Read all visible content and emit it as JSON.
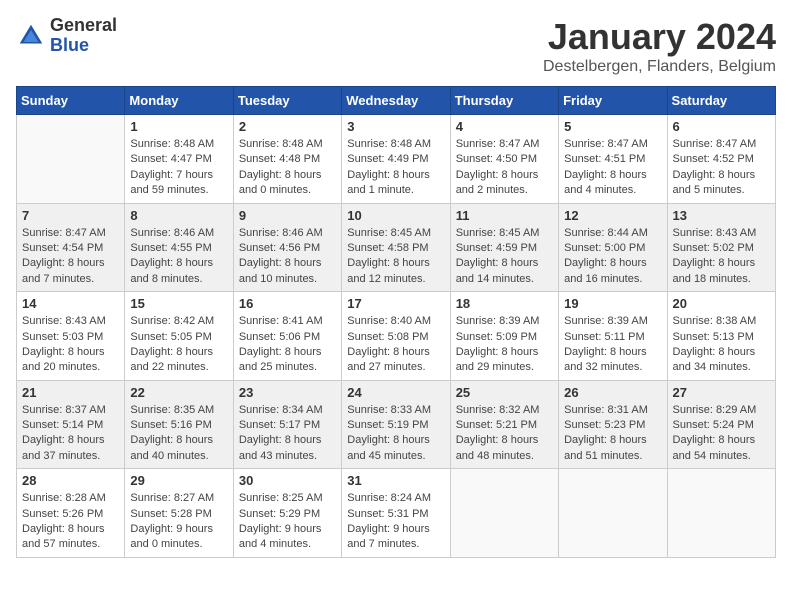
{
  "header": {
    "logo_general": "General",
    "logo_blue": "Blue",
    "month": "January 2024",
    "location": "Destelbergen, Flanders, Belgium"
  },
  "days_of_week": [
    "Sunday",
    "Monday",
    "Tuesday",
    "Wednesday",
    "Thursday",
    "Friday",
    "Saturday"
  ],
  "weeks": [
    [
      {
        "day": "",
        "empty": true
      },
      {
        "day": "1",
        "sunrise": "Sunrise: 8:48 AM",
        "sunset": "Sunset: 4:47 PM",
        "daylight": "Daylight: 7 hours and 59 minutes."
      },
      {
        "day": "2",
        "sunrise": "Sunrise: 8:48 AM",
        "sunset": "Sunset: 4:48 PM",
        "daylight": "Daylight: 8 hours and 0 minutes."
      },
      {
        "day": "3",
        "sunrise": "Sunrise: 8:48 AM",
        "sunset": "Sunset: 4:49 PM",
        "daylight": "Daylight: 8 hours and 1 minute."
      },
      {
        "day": "4",
        "sunrise": "Sunrise: 8:47 AM",
        "sunset": "Sunset: 4:50 PM",
        "daylight": "Daylight: 8 hours and 2 minutes."
      },
      {
        "day": "5",
        "sunrise": "Sunrise: 8:47 AM",
        "sunset": "Sunset: 4:51 PM",
        "daylight": "Daylight: 8 hours and 4 minutes."
      },
      {
        "day": "6",
        "sunrise": "Sunrise: 8:47 AM",
        "sunset": "Sunset: 4:52 PM",
        "daylight": "Daylight: 8 hours and 5 minutes."
      }
    ],
    [
      {
        "day": "7",
        "sunrise": "Sunrise: 8:47 AM",
        "sunset": "Sunset: 4:54 PM",
        "daylight": "Daylight: 8 hours and 7 minutes."
      },
      {
        "day": "8",
        "sunrise": "Sunrise: 8:46 AM",
        "sunset": "Sunset: 4:55 PM",
        "daylight": "Daylight: 8 hours and 8 minutes."
      },
      {
        "day": "9",
        "sunrise": "Sunrise: 8:46 AM",
        "sunset": "Sunset: 4:56 PM",
        "daylight": "Daylight: 8 hours and 10 minutes."
      },
      {
        "day": "10",
        "sunrise": "Sunrise: 8:45 AM",
        "sunset": "Sunset: 4:58 PM",
        "daylight": "Daylight: 8 hours and 12 minutes."
      },
      {
        "day": "11",
        "sunrise": "Sunrise: 8:45 AM",
        "sunset": "Sunset: 4:59 PM",
        "daylight": "Daylight: 8 hours and 14 minutes."
      },
      {
        "day": "12",
        "sunrise": "Sunrise: 8:44 AM",
        "sunset": "Sunset: 5:00 PM",
        "daylight": "Daylight: 8 hours and 16 minutes."
      },
      {
        "day": "13",
        "sunrise": "Sunrise: 8:43 AM",
        "sunset": "Sunset: 5:02 PM",
        "daylight": "Daylight: 8 hours and 18 minutes."
      }
    ],
    [
      {
        "day": "14",
        "sunrise": "Sunrise: 8:43 AM",
        "sunset": "Sunset: 5:03 PM",
        "daylight": "Daylight: 8 hours and 20 minutes."
      },
      {
        "day": "15",
        "sunrise": "Sunrise: 8:42 AM",
        "sunset": "Sunset: 5:05 PM",
        "daylight": "Daylight: 8 hours and 22 minutes."
      },
      {
        "day": "16",
        "sunrise": "Sunrise: 8:41 AM",
        "sunset": "Sunset: 5:06 PM",
        "daylight": "Daylight: 8 hours and 25 minutes."
      },
      {
        "day": "17",
        "sunrise": "Sunrise: 8:40 AM",
        "sunset": "Sunset: 5:08 PM",
        "daylight": "Daylight: 8 hours and 27 minutes."
      },
      {
        "day": "18",
        "sunrise": "Sunrise: 8:39 AM",
        "sunset": "Sunset: 5:09 PM",
        "daylight": "Daylight: 8 hours and 29 minutes."
      },
      {
        "day": "19",
        "sunrise": "Sunrise: 8:39 AM",
        "sunset": "Sunset: 5:11 PM",
        "daylight": "Daylight: 8 hours and 32 minutes."
      },
      {
        "day": "20",
        "sunrise": "Sunrise: 8:38 AM",
        "sunset": "Sunset: 5:13 PM",
        "daylight": "Daylight: 8 hours and 34 minutes."
      }
    ],
    [
      {
        "day": "21",
        "sunrise": "Sunrise: 8:37 AM",
        "sunset": "Sunset: 5:14 PM",
        "daylight": "Daylight: 8 hours and 37 minutes."
      },
      {
        "day": "22",
        "sunrise": "Sunrise: 8:35 AM",
        "sunset": "Sunset: 5:16 PM",
        "daylight": "Daylight: 8 hours and 40 minutes."
      },
      {
        "day": "23",
        "sunrise": "Sunrise: 8:34 AM",
        "sunset": "Sunset: 5:17 PM",
        "daylight": "Daylight: 8 hours and 43 minutes."
      },
      {
        "day": "24",
        "sunrise": "Sunrise: 8:33 AM",
        "sunset": "Sunset: 5:19 PM",
        "daylight": "Daylight: 8 hours and 45 minutes."
      },
      {
        "day": "25",
        "sunrise": "Sunrise: 8:32 AM",
        "sunset": "Sunset: 5:21 PM",
        "daylight": "Daylight: 8 hours and 48 minutes."
      },
      {
        "day": "26",
        "sunrise": "Sunrise: 8:31 AM",
        "sunset": "Sunset: 5:23 PM",
        "daylight": "Daylight: 8 hours and 51 minutes."
      },
      {
        "day": "27",
        "sunrise": "Sunrise: 8:29 AM",
        "sunset": "Sunset: 5:24 PM",
        "daylight": "Daylight: 8 hours and 54 minutes."
      }
    ],
    [
      {
        "day": "28",
        "sunrise": "Sunrise: 8:28 AM",
        "sunset": "Sunset: 5:26 PM",
        "daylight": "Daylight: 8 hours and 57 minutes."
      },
      {
        "day": "29",
        "sunrise": "Sunrise: 8:27 AM",
        "sunset": "Sunset: 5:28 PM",
        "daylight": "Daylight: 9 hours and 0 minutes."
      },
      {
        "day": "30",
        "sunrise": "Sunrise: 8:25 AM",
        "sunset": "Sunset: 5:29 PM",
        "daylight": "Daylight: 9 hours and 4 minutes."
      },
      {
        "day": "31",
        "sunrise": "Sunrise: 8:24 AM",
        "sunset": "Sunset: 5:31 PM",
        "daylight": "Daylight: 9 hours and 7 minutes."
      },
      {
        "day": "",
        "empty": true
      },
      {
        "day": "",
        "empty": true
      },
      {
        "day": "",
        "empty": true
      }
    ]
  ]
}
